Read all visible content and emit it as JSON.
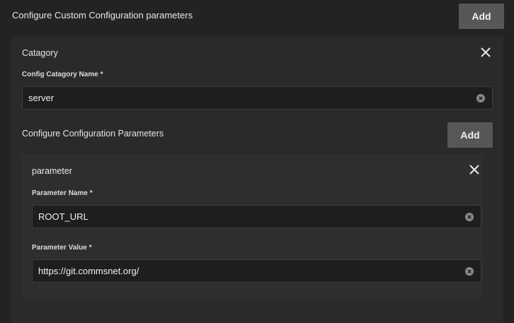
{
  "header": {
    "title": "Configure Custom Configuration parameters",
    "add_label": "Add"
  },
  "category": {
    "title": "Catagory",
    "name_label": "Config Catagory Name *",
    "name_value": "server",
    "params_title": "Configure Configuration Parameters",
    "params_add_label": "Add"
  },
  "parameter": {
    "title": "parameter",
    "name_label": "Parameter Name *",
    "name_value": "ROOT_URL",
    "value_label": "Parameter Value *",
    "value_value": "https://git.commsnet.org/"
  },
  "icons": {
    "close": "close-icon",
    "clear": "clear-icon"
  },
  "colors": {
    "background": "#232323",
    "panel": "#2a2a2a",
    "button": "#575757",
    "input_bg": "#1e1e1e"
  }
}
